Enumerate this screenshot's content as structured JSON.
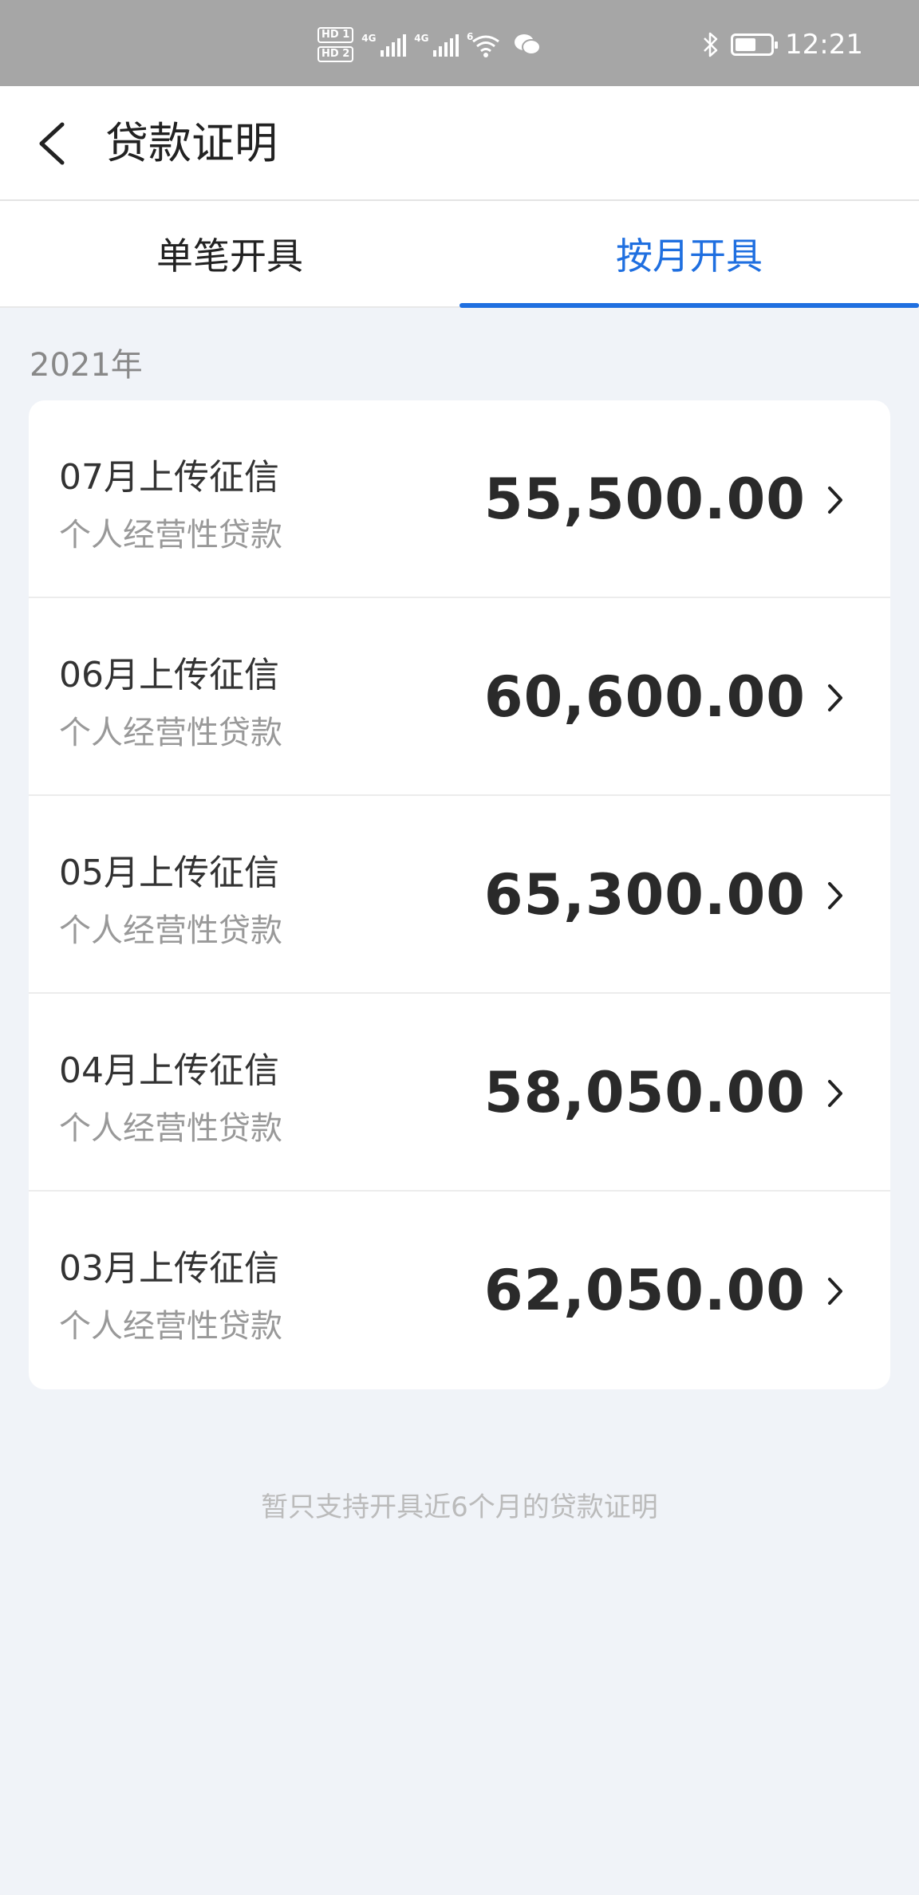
{
  "status_bar": {
    "time": "12:21",
    "hd1": "HD 1",
    "hd2": "HD 2",
    "net1": "4G",
    "net2": "4G",
    "wifi_label": "6",
    "battery_level": 0.6,
    "icons": [
      "hd-icon",
      "signal-icon",
      "wifi-icon",
      "wechat-icon",
      "bluetooth-icon",
      "battery-icon"
    ]
  },
  "header": {
    "title": "贷款证明",
    "back_icon": "chevron-left-icon"
  },
  "tabs": [
    {
      "label": "单笔开具",
      "active": false
    },
    {
      "label": "按月开具",
      "active": true
    }
  ],
  "section": {
    "year": "2021年",
    "items": [
      {
        "month": "07月上传征信",
        "type": "个人经营性贷款",
        "amount": "55,500.00"
      },
      {
        "month": "06月上传征信",
        "type": "个人经营性贷款",
        "amount": "60,600.00"
      },
      {
        "month": "05月上传征信",
        "type": "个人经营性贷款",
        "amount": "65,300.00"
      },
      {
        "month": "04月上传征信",
        "type": "个人经营性贷款",
        "amount": "58,050.00"
      },
      {
        "month": "03月上传征信",
        "type": "个人经营性贷款",
        "amount": "62,050.00"
      }
    ]
  },
  "footnote": "暂只支持开具近6个月的贷款证明",
  "colors": {
    "accent": "#1f6fe0",
    "background": "#f0f3f8",
    "status_bar": "#a6a6a6"
  }
}
